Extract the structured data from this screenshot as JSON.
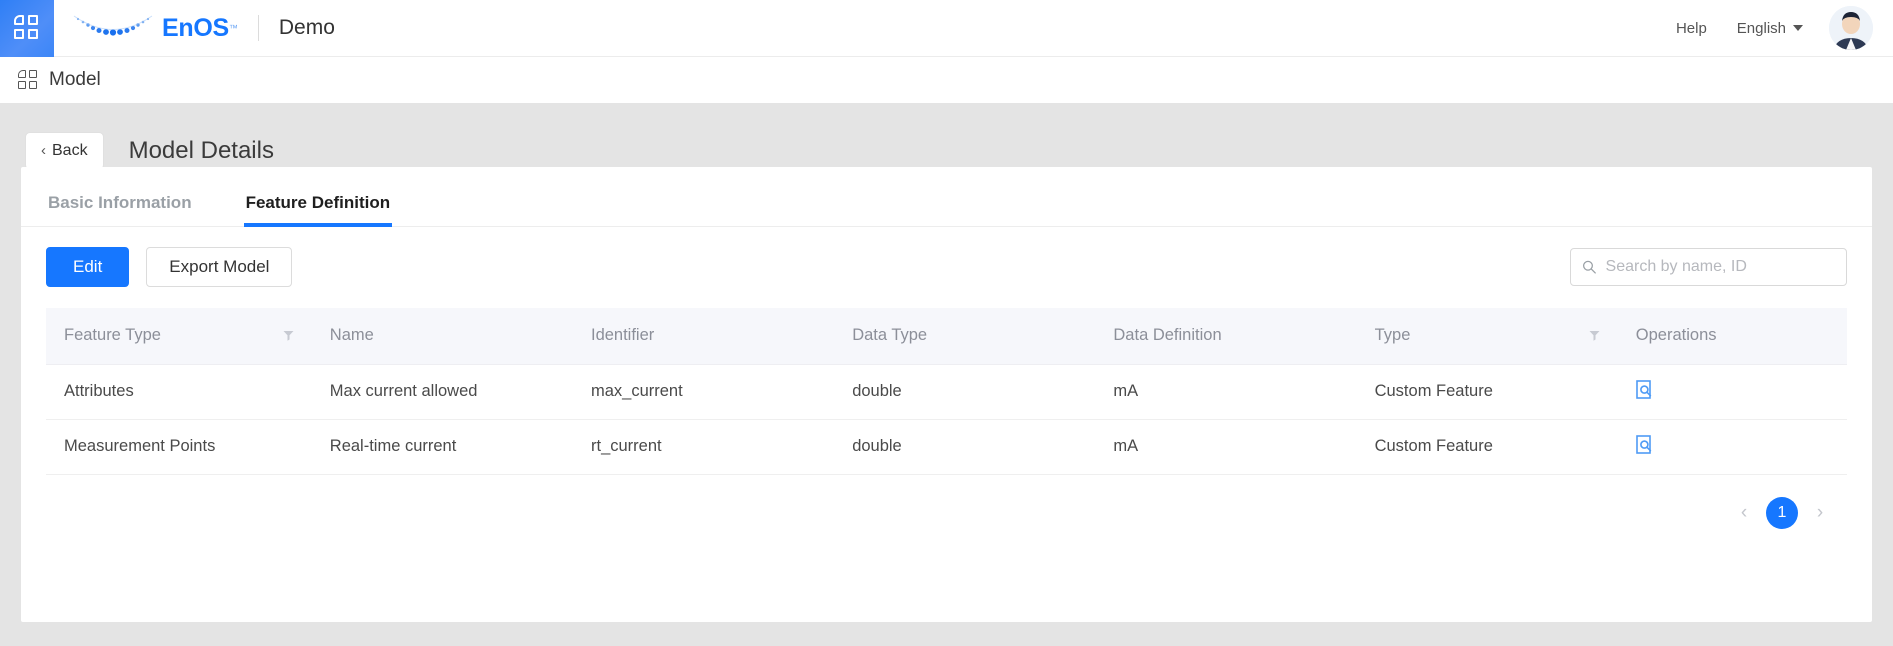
{
  "header": {
    "app_icon": "grid-apps-icon",
    "logo_text_primary": "EnOS",
    "logo_trademark": "™",
    "tenant": "Demo",
    "help_label": "Help",
    "language_label": "English",
    "avatar": "user-avatar"
  },
  "breadcrumb": {
    "icon": "grid-model-icon",
    "label": "Model"
  },
  "page": {
    "back_label": "Back",
    "back_chevron": "‹",
    "title": "Model Details"
  },
  "tabs": [
    {
      "label": "Basic Information",
      "active": false
    },
    {
      "label": "Feature Definition",
      "active": true
    }
  ],
  "toolbar": {
    "edit_label": "Edit",
    "export_label": "Export Model",
    "search_placeholder": "Search by name, ID",
    "search_value": ""
  },
  "table": {
    "columns": [
      {
        "label": "Feature Type",
        "filter": true
      },
      {
        "label": "Name",
        "filter": false
      },
      {
        "label": "Identifier",
        "filter": false
      },
      {
        "label": "Data Type",
        "filter": false
      },
      {
        "label": "Data Definition",
        "filter": false
      },
      {
        "label": "Type",
        "filter": true
      },
      {
        "label": "Operations",
        "filter": false
      }
    ],
    "rows": [
      {
        "feature_type": "Attributes",
        "name": "Max current allowed",
        "identifier": "max_current",
        "data_type": "double",
        "data_definition": "mA",
        "type": "Custom Feature",
        "operation_icon": "view-details-icon"
      },
      {
        "feature_type": "Measurement Points",
        "name": "Real-time current",
        "identifier": "rt_current",
        "data_type": "double",
        "data_definition": "mA",
        "type": "Custom Feature",
        "operation_icon": "view-details-icon"
      }
    ]
  },
  "pagination": {
    "prev": "‹",
    "current_page": "1",
    "next": "›"
  },
  "colors": {
    "accent": "#1677ff",
    "page_bg": "#e4e4e4",
    "table_header_bg": "#f6f7fb",
    "muted_text": "#8c8f99"
  }
}
